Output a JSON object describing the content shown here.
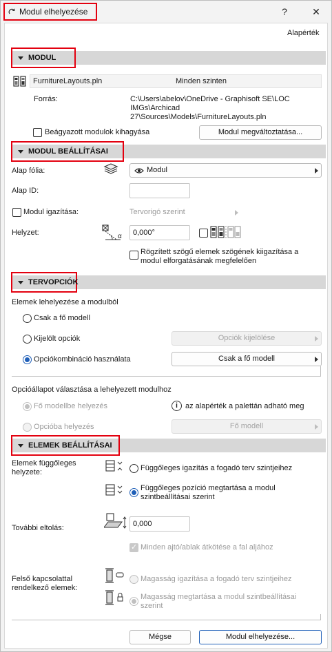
{
  "window": {
    "title": "Modul elhelyezése",
    "help_label": "?",
    "close_label": "✕",
    "default_label": "Alapérték"
  },
  "modul": {
    "header": "MODUL",
    "file_name": "FurnitureLayouts.pln",
    "story_value": "Minden szinten",
    "source_label": "Forrás:",
    "source_path": [
      "C:\\Users\\abelov\\OneDrive - Graphisoft SE\\LOC",
      "IMGs\\Archicad",
      "27\\Sources\\Models\\FurnitureLayouts.pln"
    ],
    "skip_nested_label": "Beágyazott modulok kihagyása",
    "change_module_button": "Modul megváltoztatása..."
  },
  "module_settings": {
    "header": "MODUL BEÁLLÍTÁSAI",
    "base_layer_label": "Alap fólia:",
    "base_layer_value": "Modul",
    "base_id_label": "Alap ID:",
    "base_id_value": "",
    "align_label": "Modul igazítása:",
    "align_value": "Tervorigó szerint",
    "position_label": "Helyzet:",
    "angle_value": "0,000°",
    "alpha_glyph": "α",
    "fixed_angle_label": [
      "Rögzített szögű elemek szögének kiigazítása a",
      "modul elforgatásának megfelelően"
    ]
  },
  "design_options": {
    "header": "TERVOPCIÓK",
    "placement_heading": "Elemek lehelyezése a modulból",
    "radio_main_only": "Csak a fő modell",
    "radio_selected": "Kijelölt opciók",
    "select_options_button": "Opciók kijelölése",
    "radio_combination": "Opciókombináció használata",
    "combination_value": "Csak a fő modell",
    "state_heading": "Opcióállapot választása a lehelyezett modulhoz",
    "radio_place_main": "Fő modellbe helyezés",
    "info_glyph": "i",
    "info_text": "az alapérték a palettán adható meg",
    "radio_place_option": "Opcióba helyezés",
    "main_model_value": "Fő modell"
  },
  "element_settings": {
    "header": "ELEMEK BEÁLLÍTÁSAI",
    "vertical_label": [
      "Elemek függőleges",
      "helyzete:"
    ],
    "vertical_opt1": "Függőleges igazítás a fogadó terv szintjeihez",
    "vertical_opt2": [
      "Függőleges pozíció megtartása a modul",
      "szintbeállításai szerint"
    ],
    "offset_label": "További eltolás:",
    "offset_value": "0,000",
    "door_window_label": "Minden ajtó/ablak átkötése a fal aljához",
    "top_linked_label": [
      "Felső kapcsolattal",
      "rendelkező elemek:"
    ],
    "top_opt1": "Magasság igazítása a fogadó terv szintjeihez",
    "top_opt2": [
      "Magasság megtartása a modul szintbeállításai",
      "szerint"
    ]
  },
  "footer": {
    "cancel_button": "Mégse",
    "place_button": "Modul elhelyezése..."
  },
  "colors": {
    "highlight_red": "#e3000f",
    "accent_blue": "#1f5fb8",
    "section_bar": "#d7d7d7"
  }
}
